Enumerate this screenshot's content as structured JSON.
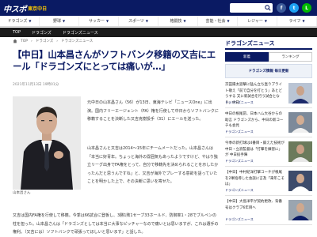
{
  "header": {
    "logo_main": "中スポ",
    "logo_sub": "東京中日",
    "search_placeholder": "",
    "social": {
      "facebook": "f",
      "twitter": "t",
      "line": "L"
    }
  },
  "categories": [
    {
      "label": "ドラゴンズ"
    },
    {
      "label": "野球"
    },
    {
      "label": "サッカー"
    },
    {
      "label": "スポーツ"
    },
    {
      "label": "格闘技"
    },
    {
      "label": "芸能・社会"
    },
    {
      "label": "レジャー"
    },
    {
      "label": "ライフ"
    }
  ],
  "subnav": [
    "TOP",
    "ドラゴンズ",
    "ドラゴンズニュース"
  ],
  "breadcrumb": [
    "TOP",
    "ドラゴンズ",
    "ドラゴンズニュース"
  ],
  "article": {
    "title": "【中日】山本昌さんがソフトバンク移籍の又吉にエール「ドラゴンズにとっては痛いが…」",
    "timestamp": "2021年11月13日 19時01分",
    "photo_caption": "山本昌さん",
    "p1": "元中日の山本昌さん（56）が13日、東海テレビ「ニュースOne」に出演。国内フリーエージェント（FA）権を行使して中日からソフトバンクに移籍することを決断した又吉克樹投手（31）にエールを送った。",
    "p2": "山本昌さんと又吉は2014～15年にチームメートだった。山本昌さんは「本当に好青年。ちょっと海外の雰囲気もあったようですけど、やはり独立リーグ出身でFA権をとって、自分で移籍先を決められることを示したかったんだと思うんですね」と、又吉が海外でプレーする意欲を語っていたことを明かした上で、その決断に思いを寄せた。",
    "p3": "又吉は国内FA権を行使して移籍。今季は66試合に登板し、3勝1敗1セーブ33ホールド、防御率1・28でブルペンの柱を担った。山本昌さんは「ドラゴンズとしては本当に大事なピッチャーなので痛いとは思いますが、これは選手の権利。（又吉には）ソフトバンクで頑張ってほしいと思います」と話した。"
  },
  "sidebar": {
    "title": "ドラゴンズニュース",
    "tabs": [
      {
        "label": "新着"
      },
      {
        "label": "ランキング"
      }
    ],
    "banner": "ドラゴンズ情報 毎日更新",
    "news": [
      {
        "text": "京田陽太遊撃に猛ん立ち直りプライト敬え「前で自分を打とう」あとどうする 又に新試合を行う試合となり、中日",
        "tag": "ドラゴンズニュース"
      },
      {
        "text": "中日の根尾昂、日本ハム大谷からの助言 ドラゴンズから、中日の新コーチも会見",
        "tag": "ドラゴンズニュース"
      },
      {
        "text": "今季の新打球は4番目・鍛えた技術が中日・立浪監督は「打撃を練習に」が 中日投手陣",
        "tag": "ドラゴンズニュース"
      },
      {
        "text": "【中日】中村紀洋打撃コーチが根尾を2軍指導した会談に言及「来年こそは」",
        "tag": "ドラゴンズニュース"
      },
      {
        "text": "【中日】大島洋平が契約更改、背番号はクラブ6年目へ",
        "tag": "ドラゴンズニュース"
      }
    ]
  }
}
